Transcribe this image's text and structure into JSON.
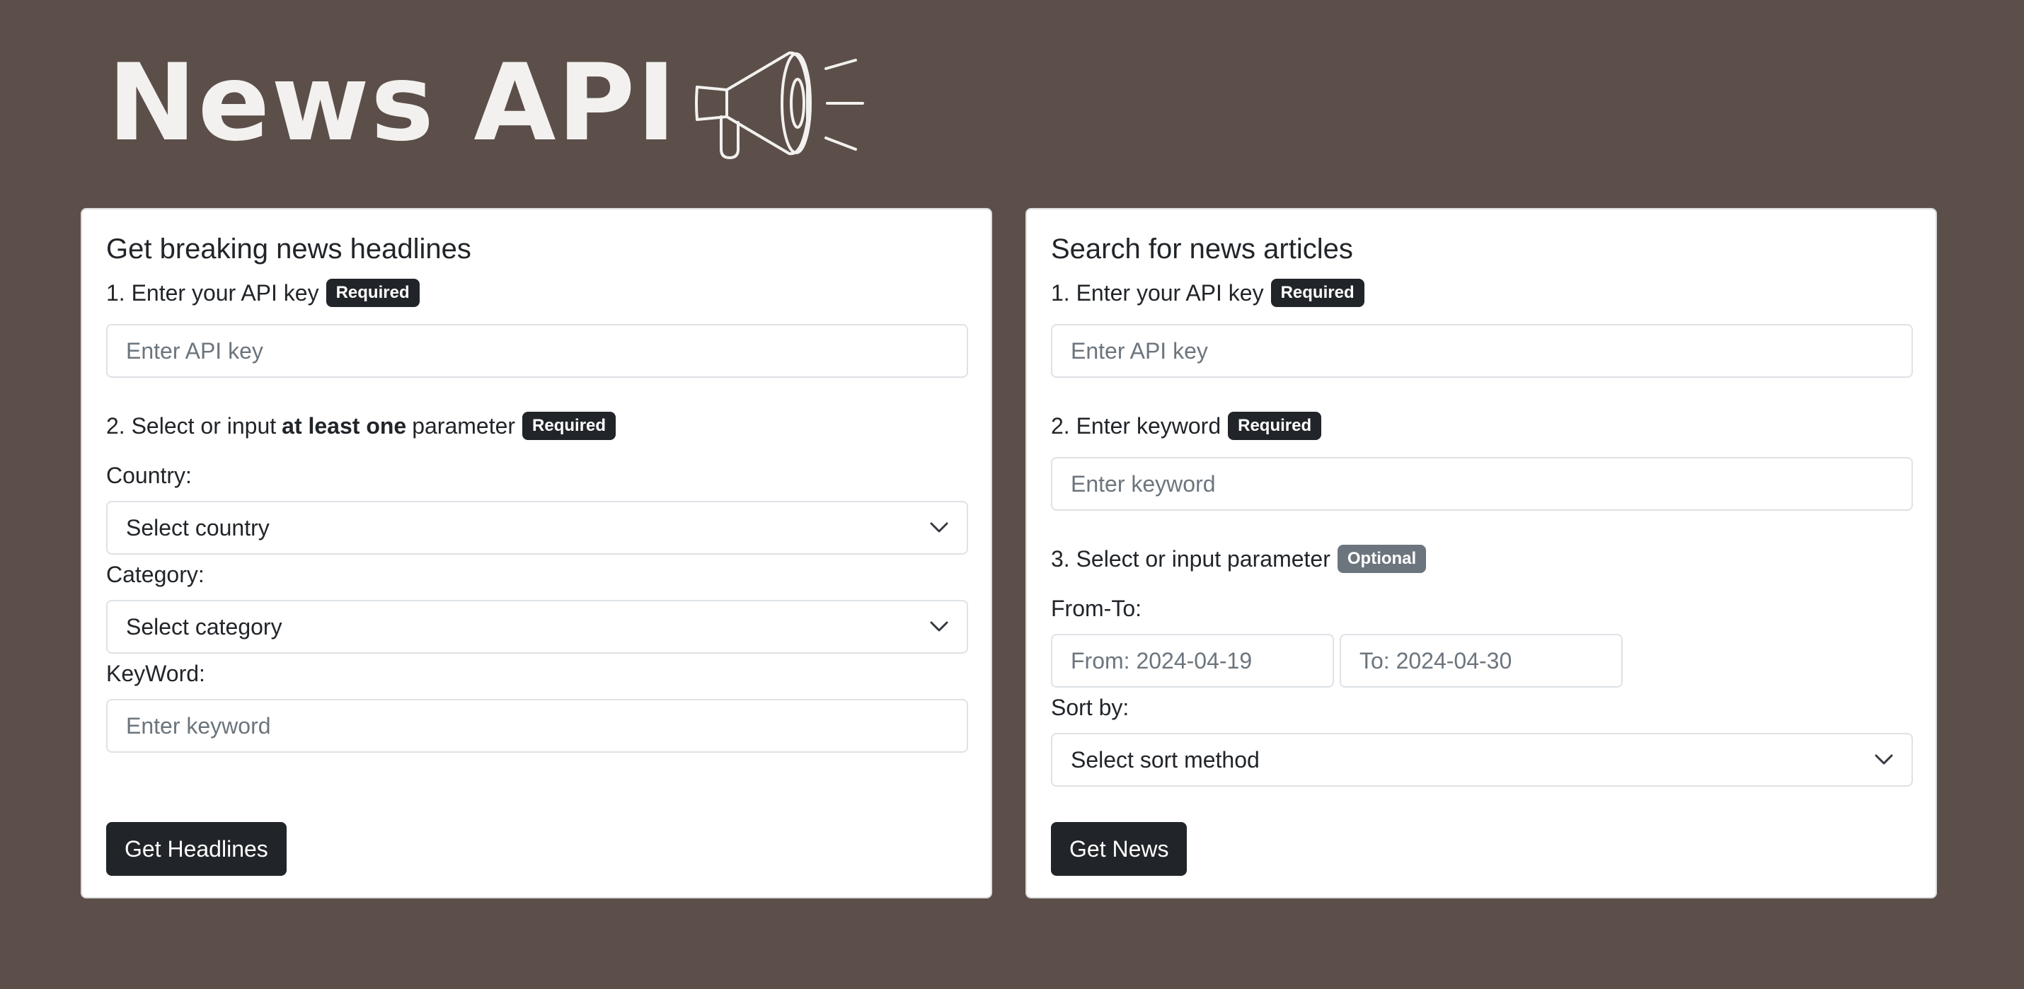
{
  "logo": {
    "text": "News API",
    "icon": "megaphone-icon"
  },
  "headlines": {
    "title": "Get breaking news headlines",
    "step1": {
      "label": "1. Enter your API key",
      "badge": "Required"
    },
    "api_key": {
      "placeholder": "Enter API key"
    },
    "step2": {
      "prefix": "2. Select or input",
      "bold": "at least one",
      "suffix": "parameter",
      "badge": "Required"
    },
    "country": {
      "label": "Country:",
      "selected": "Select country"
    },
    "category": {
      "label": "Category:",
      "selected": "Select category"
    },
    "keyword": {
      "label": "KeyWord:",
      "placeholder": "Enter keyword"
    },
    "submit": "Get Headlines"
  },
  "search": {
    "title": "Search for news articles",
    "step1": {
      "label": "1. Enter your API key",
      "badge": "Required"
    },
    "api_key": {
      "placeholder": "Enter API key"
    },
    "step2": {
      "label": "2. Enter keyword",
      "badge": "Required"
    },
    "keyword": {
      "placeholder": "Enter keyword"
    },
    "step3": {
      "label": "3. Select or input parameter",
      "badge": "Optional"
    },
    "range": {
      "label": "From-To:",
      "from_placeholder": "From: 2024-04-19",
      "to_placeholder": "To: 2024-04-30"
    },
    "sort": {
      "label": "Sort by:",
      "selected": "Select sort method"
    },
    "submit": "Get News"
  },
  "colors": {
    "background": "#5c4f49",
    "card": "#ffffff",
    "button": "#212529",
    "badge_required": "#212529",
    "badge_optional": "#6c757d"
  }
}
